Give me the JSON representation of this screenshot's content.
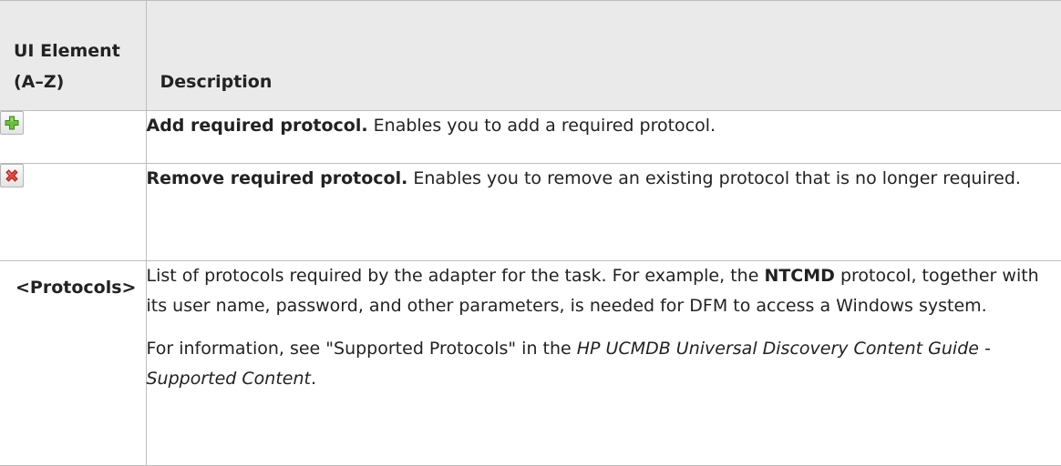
{
  "table": {
    "header": {
      "element": "UI Element (A–Z)",
      "description": "Description"
    },
    "rows": [
      {
        "icon": "add-icon",
        "title": "Add required protocol.",
        "text": " Enables you to add a required protocol."
      },
      {
        "icon": "remove-icon",
        "title": "Remove required protocol.",
        "text": " Enables you to remove an existing protocol that is no longer required."
      },
      {
        "element": "<Protocols>",
        "p1_before": "List of protocols required by the adapter for the task. For example, the ",
        "p1_strong": "NTCMD",
        "p1_after": " protocol, together with its user name, password, and other parameters, is needed for DFM to access a Windows system.",
        "p2_before": "For information, see \"Supported Protocols\" in the ",
        "p2_em": "HP UCMDB Universal Discovery Content Guide - Supported Content",
        "p2_after": "."
      }
    ]
  },
  "colors": {
    "header_bg": "#eaeaea",
    "border": "#bdbdbd",
    "add_icon_green": "#5fb82e",
    "remove_icon_red": "#e0413a"
  }
}
